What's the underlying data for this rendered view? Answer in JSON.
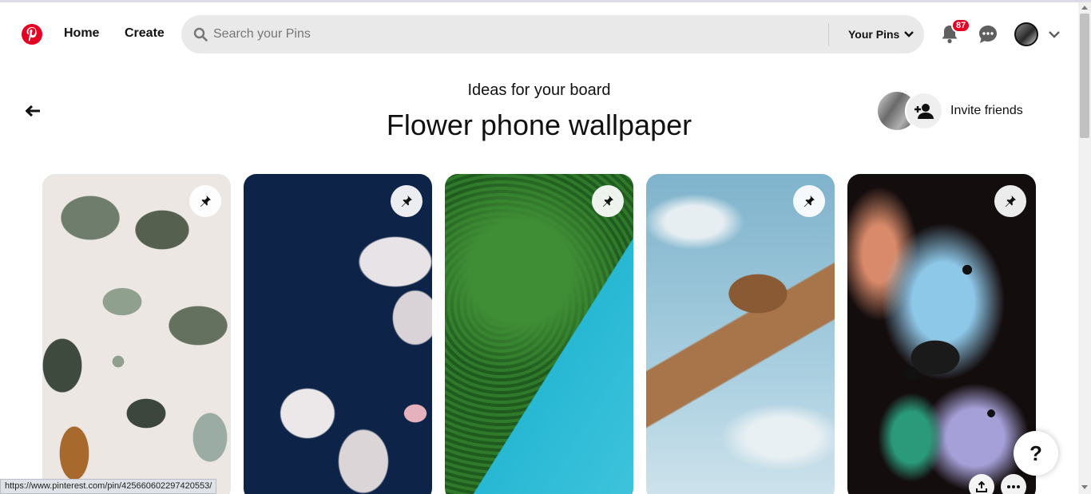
{
  "header": {
    "logo_icon": "pinterest-logo-icon",
    "nav": {
      "home": "Home",
      "create": "Create"
    },
    "search": {
      "placeholder": "Search your Pins",
      "value": ""
    },
    "your_pins": "Your Pins",
    "notifications_count": "87",
    "brand_color": "#e60023"
  },
  "board": {
    "subtitle": "Ideas for your board",
    "title": "Flower phone wallpaper",
    "invite_label": "Invite friends"
  },
  "pins": [
    {
      "id": "pin-1",
      "description": "3D green blobs wallpaper"
    },
    {
      "id": "pin-2",
      "description": "white blossoms on navy"
    },
    {
      "id": "pin-3",
      "description": "aerial forest and lake"
    },
    {
      "id": "pin-4",
      "description": "giraffe against sky"
    },
    {
      "id": "pin-5",
      "description": "abstract ink swirl"
    }
  ],
  "help_label": "?",
  "status_url": "https://www.pinterest.com/pin/425660602297420553/"
}
